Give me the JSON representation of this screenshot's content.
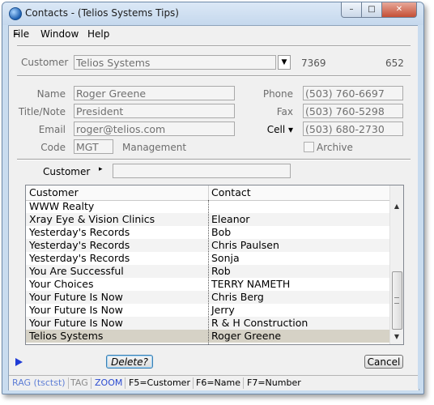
{
  "window": {
    "title": "Contacts - (Telios Systems Tips)",
    "minimize_icon": "minimize-icon",
    "maximize_icon": "maximize-icon",
    "close_icon": "close-icon"
  },
  "menu": {
    "items": [
      "File",
      "Window",
      "Help"
    ]
  },
  "customer": {
    "label": "Customer",
    "value": "Telios Systems",
    "id": "7369",
    "count": "652"
  },
  "form": {
    "name_label": "Name",
    "name": "Roger Greene",
    "title_label": "Title/Note",
    "title": "President",
    "email_label": "Email",
    "email": "roger@telios.com",
    "code_label": "Code",
    "code": "MGT",
    "code_desc": "Management",
    "phone_label": "Phone",
    "phone": "(503) 760-6697",
    "fax_label": "Fax",
    "fax": "(503) 760-5298",
    "cell_label": "Cell ▾",
    "cell": "(503) 680-2730",
    "archive_label": "Archive"
  },
  "filter": {
    "label": "Customer",
    "arrow": "▸",
    "value": ""
  },
  "grid": {
    "columns": [
      "Customer",
      "Contact"
    ],
    "rows": [
      [
        "WWW Realty",
        ""
      ],
      [
        "Xray Eye & Vision Clinics",
        "Eleanor"
      ],
      [
        "Yesterday's Records",
        "Bob"
      ],
      [
        "Yesterday's Records",
        "Chris Paulsen"
      ],
      [
        "Yesterday's Records",
        "Sonja"
      ],
      [
        "You Are Successful",
        "Rob"
      ],
      [
        "Your Choices",
        "TERRY NAMETH"
      ],
      [
        "Your Future Is Now",
        "Chris Berg"
      ],
      [
        "Your Future Is Now",
        "Jerry"
      ],
      [
        "Your Future Is Now",
        "R & H Construction"
      ],
      [
        "Telios Systems",
        "Roger Greene"
      ]
    ],
    "selected_index": 10
  },
  "buttons": {
    "delete": "Delete?",
    "cancel": "Cancel"
  },
  "status": {
    "rag": "RAG (tsctst)",
    "tag": "TAG",
    "zoom": "ZOOM",
    "f5": "F5=Customer",
    "f6": "F6=Name",
    "f7": "F7=Number"
  },
  "colors": {
    "accent": "#1f3bd6",
    "selected_row": "#d6d2c6",
    "status_blue": "#3a5fcd"
  }
}
